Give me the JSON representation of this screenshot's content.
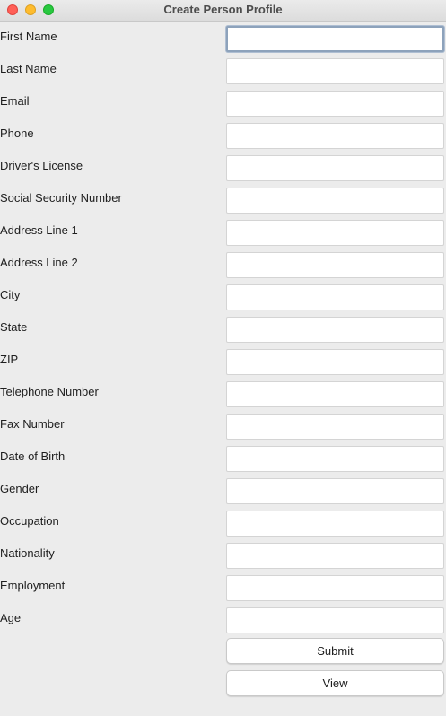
{
  "window": {
    "title": "Create Person Profile"
  },
  "form": {
    "fields": [
      {
        "label": "First Name",
        "value": "",
        "focused": true
      },
      {
        "label": "Last Name",
        "value": ""
      },
      {
        "label": "Email",
        "value": ""
      },
      {
        "label": "Phone",
        "value": ""
      },
      {
        "label": "Driver's License",
        "value": ""
      },
      {
        "label": "Social Security Number",
        "value": ""
      },
      {
        "label": "Address Line 1",
        "value": ""
      },
      {
        "label": "Address Line 2",
        "value": ""
      },
      {
        "label": "City",
        "value": ""
      },
      {
        "label": "State",
        "value": ""
      },
      {
        "label": "ZIP",
        "value": ""
      },
      {
        "label": "Telephone Number",
        "value": ""
      },
      {
        "label": "Fax Number",
        "value": ""
      },
      {
        "label": "Date of Birth",
        "value": ""
      },
      {
        "label": "Gender",
        "value": ""
      },
      {
        "label": "Occupation",
        "value": ""
      },
      {
        "label": "Nationality",
        "value": ""
      },
      {
        "label": "Employment",
        "value": ""
      },
      {
        "label": "Age",
        "value": ""
      }
    ],
    "submit_label": "Submit",
    "view_label": "View"
  }
}
